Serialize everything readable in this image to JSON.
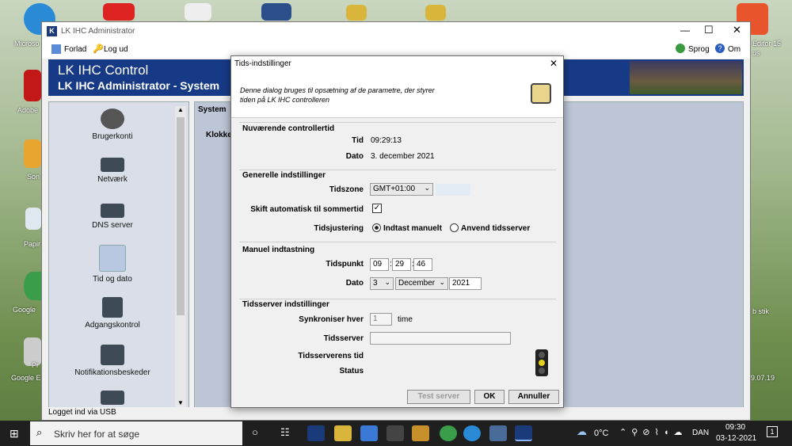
{
  "desktop": {
    "labels": [
      "Microso",
      "Adobe",
      "Son",
      "Papir",
      "Google",
      "Pr",
      "Google E",
      "Editor 15",
      "us",
      "b stik",
      "9.07.19"
    ]
  },
  "window": {
    "title": "LK IHC Administrator",
    "menu": {
      "leave": "Forlad",
      "logout": "Log ud",
      "language": "Sprog",
      "about": "Om"
    },
    "banner": {
      "line1": "LK IHC Control",
      "line2": "LK IHC Administrator - System"
    },
    "sidebar": [
      "Brugerkonti",
      "Netværk",
      "DNS server",
      "Tid og dato",
      "Adgangskontrol",
      "Notifikationsbeskeder"
    ],
    "content": {
      "tab": "System",
      "label": "Klokke"
    },
    "status": "Logget ind via USB"
  },
  "dialog": {
    "title": "Tids-indstillinger",
    "description": "Denne dialog bruges til opsætning af de parametre, der styrer tiden på LK IHC controlleren",
    "current": {
      "heading": "Nuværende controllertid",
      "time_label": "Tid",
      "time": "09:29:13",
      "date_label": "Dato",
      "date": "3. december 2021"
    },
    "general": {
      "heading": "Generelle indstillinger",
      "zone_label": "Tidszone",
      "zone": "GMT+01:00",
      "dst_label": "Skift automatisk til sommertid",
      "dst_checked": "✓",
      "adjust_label": "Tidsjustering",
      "opt_manual": "Indtast manuelt",
      "opt_server": "Anvend tidsserver"
    },
    "manual": {
      "heading": "Manuel indtastning",
      "time_label": "Tidspunkt",
      "hh": "09",
      "mm": "29",
      "ss": "46",
      "date_label": "Dato",
      "day": "3",
      "month": "December",
      "year": "2021"
    },
    "server": {
      "heading": "Tidsserver indstillinger",
      "sync_label": "Synkroniser hver",
      "sync_value": "1",
      "sync_unit": "time",
      "server_label": "Tidsserver",
      "server_value": "",
      "stime_label": "Tidsserverens tid",
      "status_label": "Status"
    },
    "buttons": {
      "test": "Test server",
      "ok": "OK",
      "cancel": "Annuller"
    }
  },
  "taskbar": {
    "search": "Skriv her for at søge",
    "temp": "0°C",
    "lang": "DAN",
    "time": "09:30",
    "date": "03-12-2021",
    "notif": "1"
  }
}
